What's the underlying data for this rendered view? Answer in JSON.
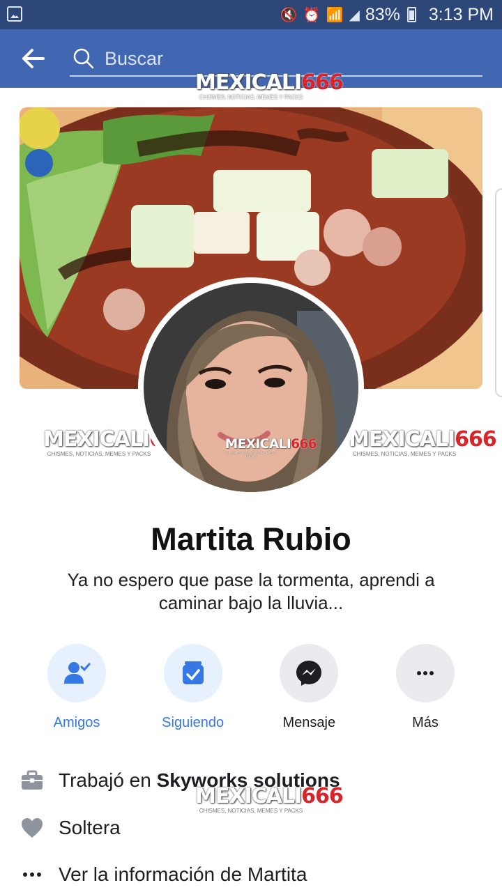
{
  "status_bar": {
    "battery": "83%",
    "time": "3:13 PM"
  },
  "header": {
    "search_placeholder": "Buscar"
  },
  "watermark": {
    "brand_a": "MEXICALI",
    "brand_b": "666",
    "tagline": "CHISMES, NOTICIAS, MEMES Y PACKS"
  },
  "profile": {
    "name": "Martita Rubio",
    "bio": "Ya no espero que pase la tormenta, aprendi a caminar bajo la lluvia..."
  },
  "actions": [
    {
      "label": "Amigos",
      "icon": "friends-check-icon"
    },
    {
      "label": "Siguiendo",
      "icon": "following-check-icon"
    },
    {
      "label": "Mensaje",
      "icon": "messenger-icon"
    },
    {
      "label": "Más",
      "icon": "more-dots-icon"
    }
  ],
  "info": {
    "work_prefix": "Trabajó en ",
    "work_company": "Skyworks solutions",
    "relationship": "Soltera",
    "see_info": "Ver la información de Martita"
  },
  "colors": {
    "app_bar": "#4267b2",
    "status_bar": "#2d4778",
    "accent_blue": "#3578e5",
    "watermark_red": "#d4262b"
  }
}
